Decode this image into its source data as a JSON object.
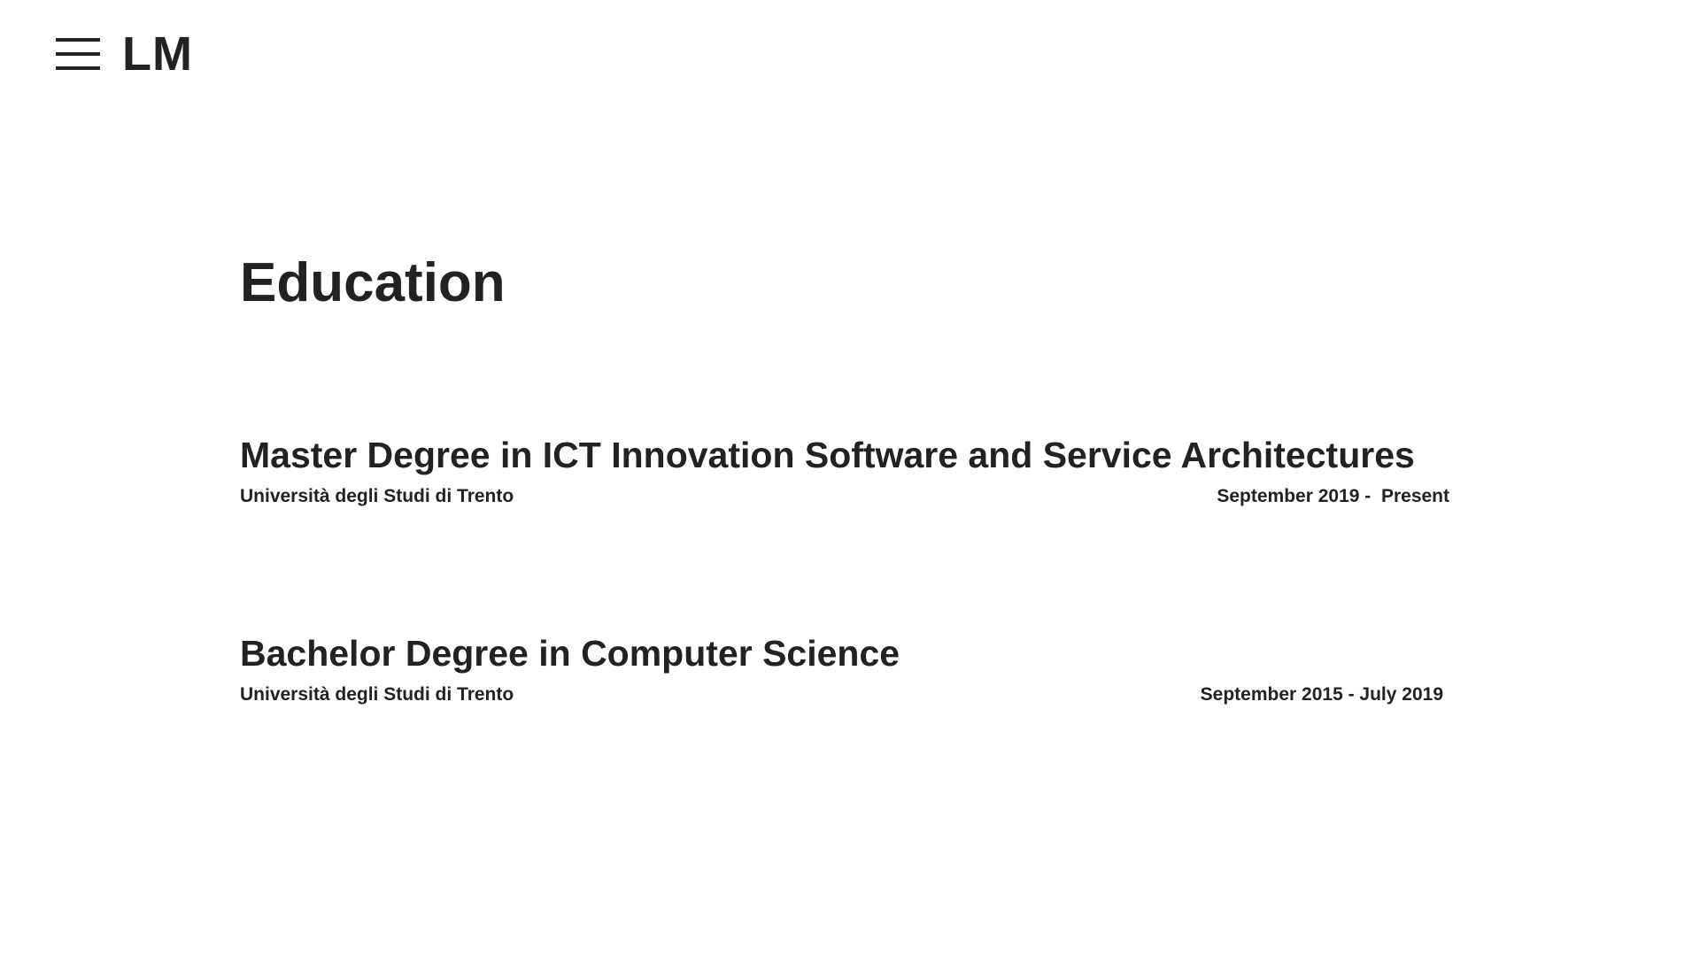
{
  "header": {
    "logo": "LM",
    "menu_icon": "hamburger-menu-icon"
  },
  "main": {
    "title": "Education",
    "entries": [
      {
        "degree": "Master Degree in ICT Innovation Software and Service Architectures",
        "school": "Università degli Studi di Trento",
        "dates": "September 2019 -  Present"
      },
      {
        "degree": "Bachelor Degree in Computer Science",
        "school": "Università degli Studi di Trento",
        "dates": "September 2015 - July 2019"
      }
    ]
  },
  "colors": {
    "text": "#222222",
    "background": "#ffffff"
  }
}
